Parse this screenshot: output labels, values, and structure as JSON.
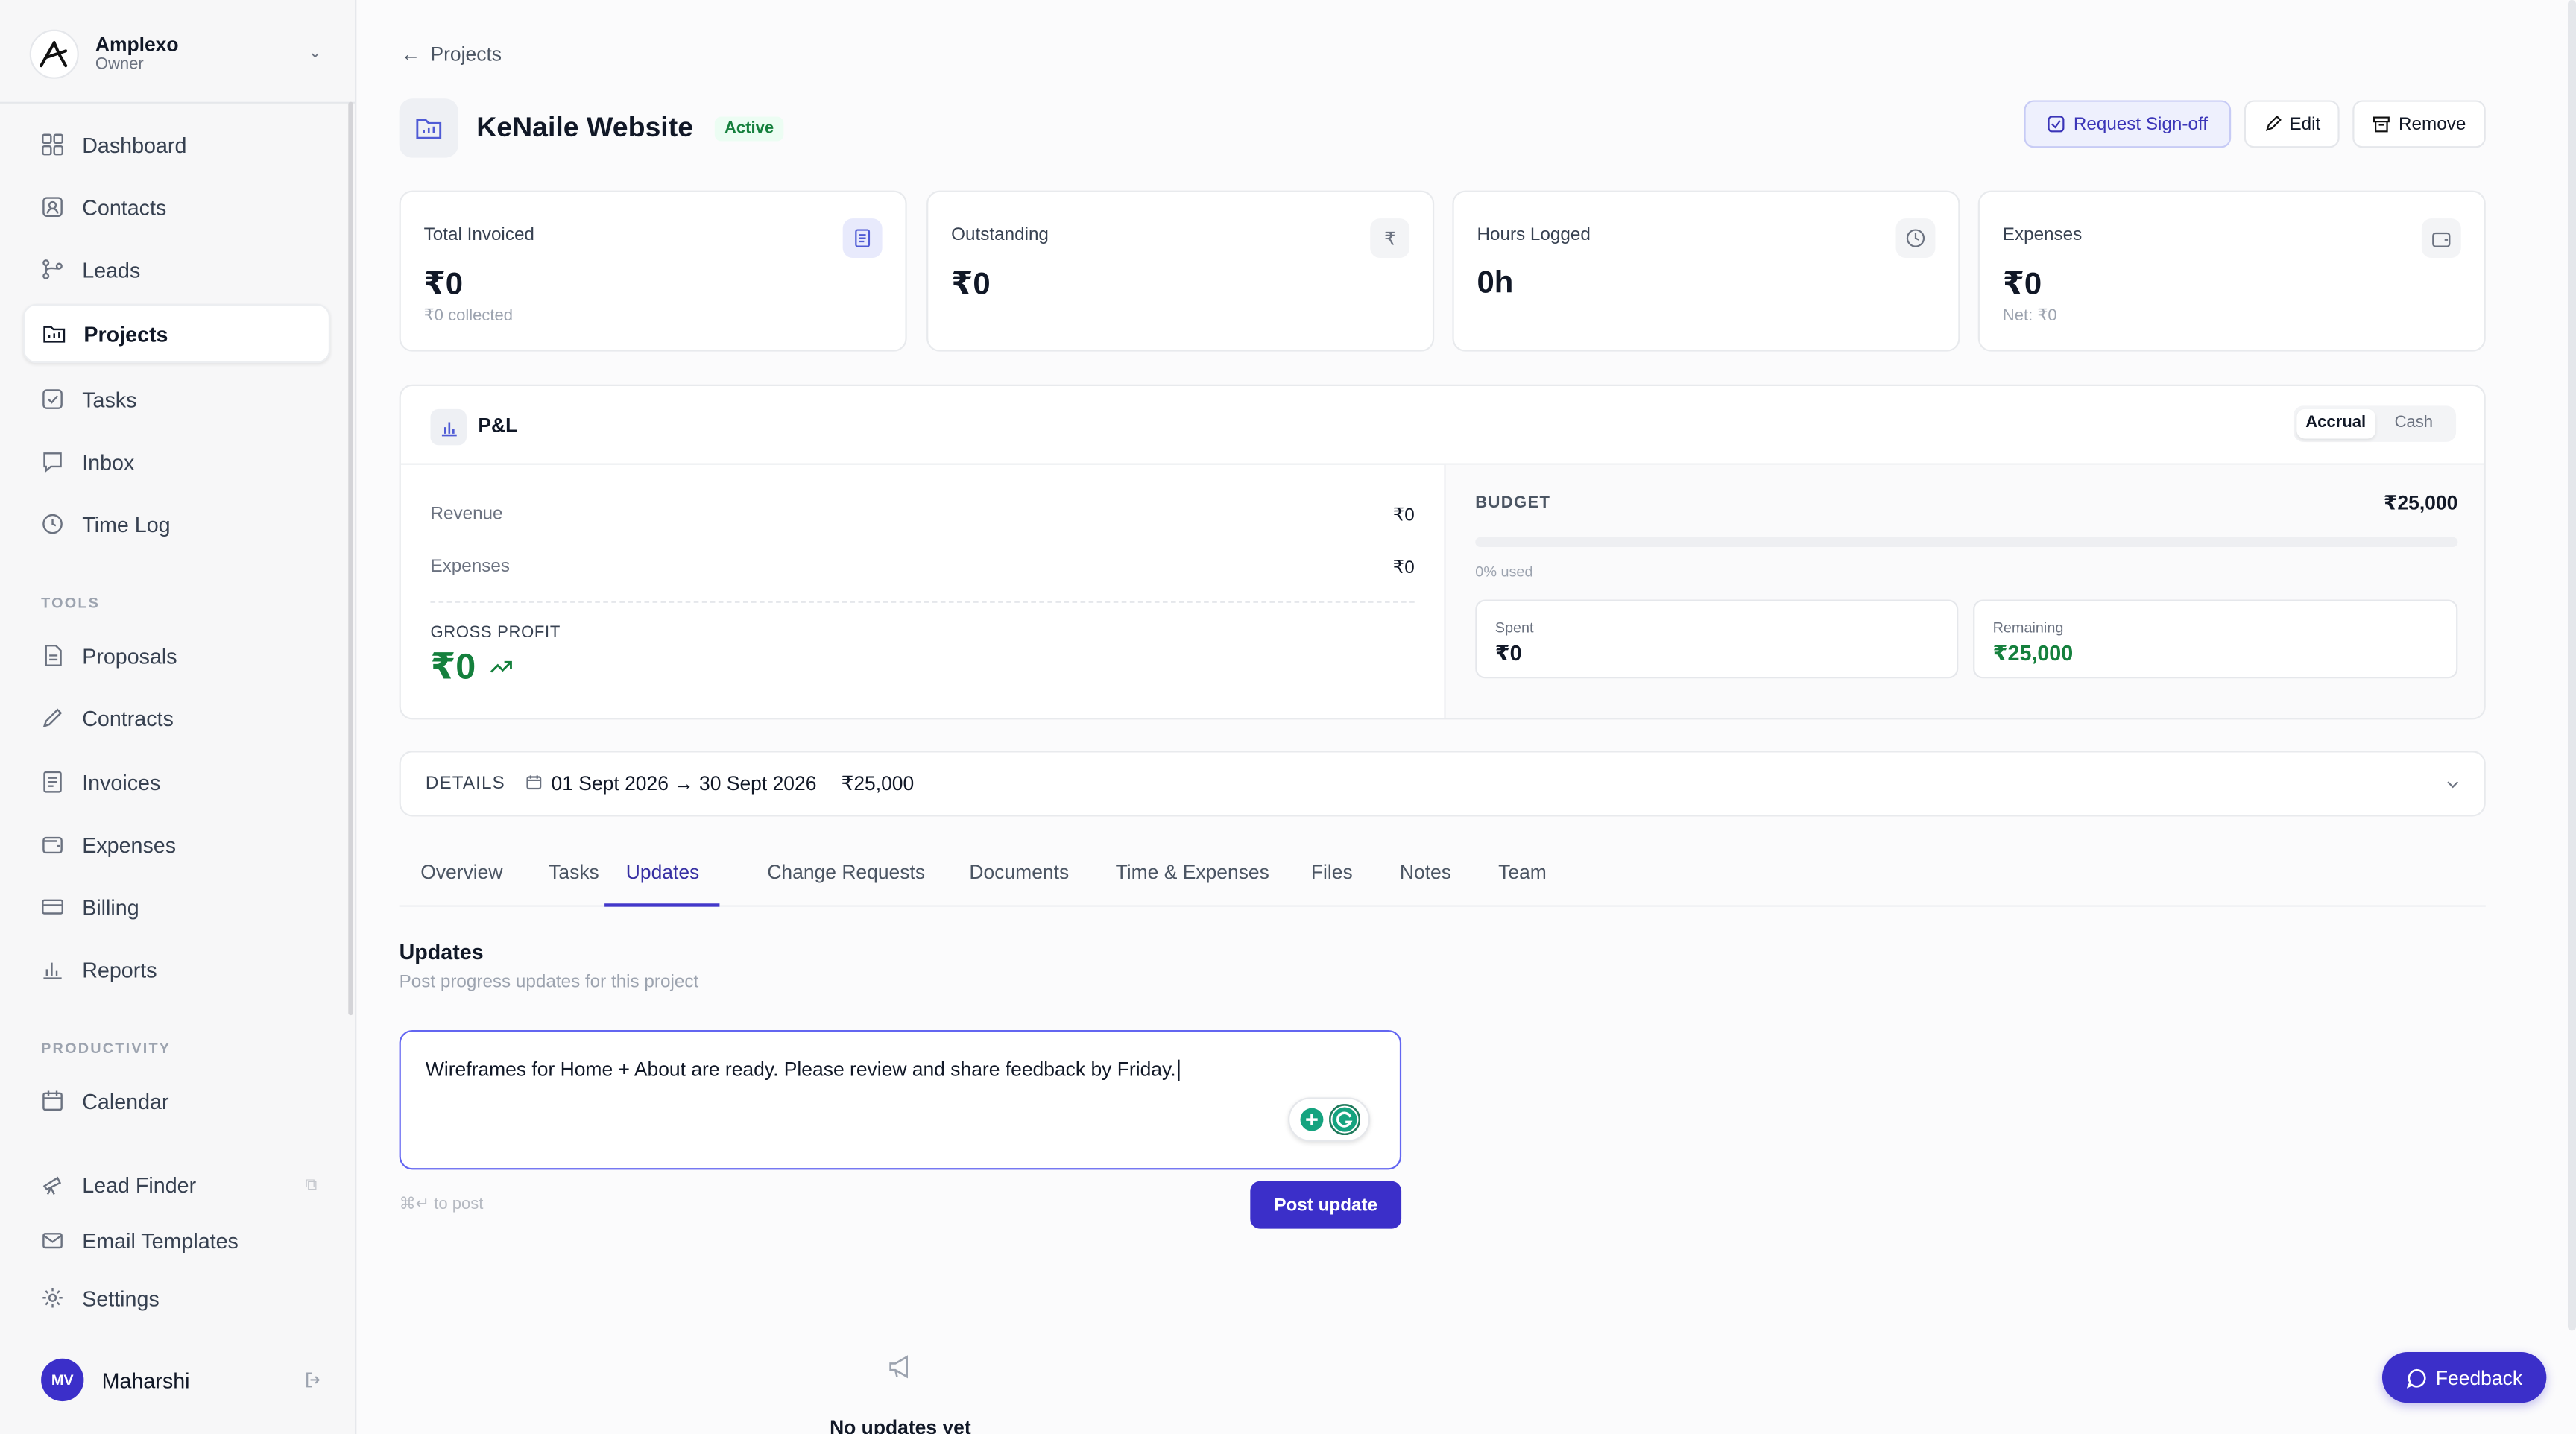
{
  "sidebar": {
    "org_name": "Amplexo",
    "org_role": "Owner",
    "items": [
      {
        "label": "Dashboard",
        "icon": "grid-icon"
      },
      {
        "label": "Contacts",
        "icon": "contact-icon"
      },
      {
        "label": "Leads",
        "icon": "branch-icon"
      },
      {
        "label": "Projects",
        "icon": "folder-icon",
        "active": true
      },
      {
        "label": "Tasks",
        "icon": "checkbox-icon"
      },
      {
        "label": "Inbox",
        "icon": "message-icon"
      },
      {
        "label": "Time Log",
        "icon": "clock-icon"
      }
    ],
    "tools_label": "TOOLS",
    "tools": [
      {
        "label": "Proposals",
        "icon": "document-icon"
      },
      {
        "label": "Contracts",
        "icon": "pen-icon"
      },
      {
        "label": "Invoices",
        "icon": "invoice-icon"
      },
      {
        "label": "Expenses",
        "icon": "wallet-icon"
      },
      {
        "label": "Billing",
        "icon": "card-icon"
      },
      {
        "label": "Reports",
        "icon": "chart-icon"
      }
    ],
    "productivity_label": "PRODUCTIVITY",
    "productivity": [
      {
        "label": "Calendar",
        "icon": "calendar-icon"
      },
      {
        "label": "Lead Finder",
        "icon": "telescope-icon"
      },
      {
        "label": "Email Templates",
        "icon": "mail-icon"
      },
      {
        "label": "Settings",
        "icon": "gear-icon"
      }
    ],
    "user": {
      "initials": "MV",
      "name": "Maharshi"
    }
  },
  "header": {
    "back_label": "Projects",
    "title": "KeNaile Website",
    "status": "Active",
    "actions": {
      "signoff": "Request Sign-off",
      "edit": "Edit",
      "remove": "Remove"
    }
  },
  "stats": [
    {
      "label": "Total Invoiced",
      "value": "₹0",
      "sub": "₹0 collected",
      "icon": "invoice-icon"
    },
    {
      "label": "Outstanding",
      "value": "₹0",
      "sub": "",
      "icon": "rupee-icon"
    },
    {
      "label": "Hours Logged",
      "value": "0h",
      "sub": "",
      "icon": "clock-icon"
    },
    {
      "label": "Expenses",
      "value": "₹0",
      "sub": "Net: ₹0",
      "icon": "wallet-icon"
    }
  ],
  "pl": {
    "title": "P&L",
    "toggle": [
      "Accrual",
      "Cash"
    ],
    "revenue_label": "Revenue",
    "revenue": "₹0",
    "expenses_label": "Expenses",
    "expenses": "₹0",
    "gross_label": "GROSS PROFIT",
    "gross": "₹0",
    "budget_label": "BUDGET",
    "budget": "₹25,000",
    "used_fraction": 0,
    "used_text": "0% used",
    "spent_label": "Spent",
    "spent": "₹0",
    "remaining_label": "Remaining",
    "remaining": "₹25,000"
  },
  "details": {
    "label": "DETAILS",
    "dates": "01 Sept 2026 → 30 Sept 2026",
    "amount": "₹25,000"
  },
  "tabs": [
    "Overview",
    "Tasks",
    "Updates",
    "Change Requests",
    "Documents",
    "Time & Expenses",
    "Files",
    "Notes",
    "Team"
  ],
  "active_tab": "Updates",
  "updates": {
    "title": "Updates",
    "subtitle": "Post progress updates for this project",
    "draft": "Wireframes for Home + About are ready. Please review and share feedback by Friday.",
    "hint": "⌘↵ to post",
    "post_label": "Post update",
    "empty": "No updates yet"
  },
  "feedback_label": "Feedback",
  "colors": {
    "accent": "#3b2fc9",
    "positive": "#15803d"
  }
}
